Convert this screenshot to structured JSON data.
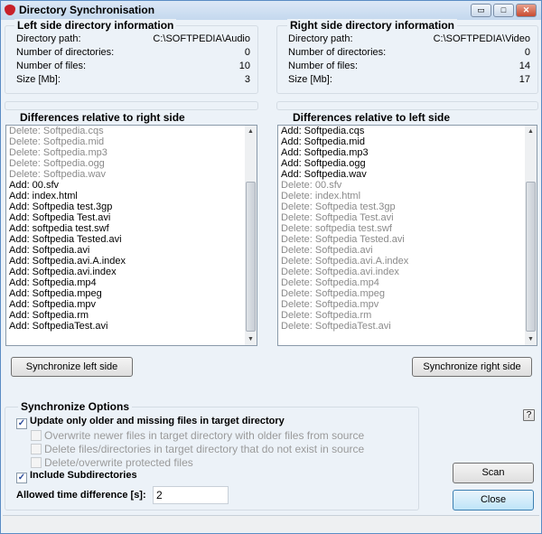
{
  "window": {
    "title": "Directory Synchronisation"
  },
  "left_info": {
    "title": "Left side directory information",
    "rows": [
      {
        "label": "Directory path:",
        "value": "C:\\SOFTPEDIA\\Audio"
      },
      {
        "label": "Number of directories:",
        "value": "0"
      },
      {
        "label": "Number of files:",
        "value": "10"
      },
      {
        "label": "Size [Mb]:",
        "value": "3"
      }
    ]
  },
  "right_info": {
    "title": "Right side directory information",
    "rows": [
      {
        "label": "Directory path:",
        "value": "C:\\SOFTPEDIA\\Video"
      },
      {
        "label": "Number of directories:",
        "value": "0"
      },
      {
        "label": "Number of files:",
        "value": "14"
      },
      {
        "label": "Size [Mb]:",
        "value": "17"
      }
    ]
  },
  "left_diff": {
    "title": "Differences relative to right side",
    "items": [
      {
        "text": "Delete: Softpedia.cqs",
        "gray": true
      },
      {
        "text": "Delete: Softpedia.mid",
        "gray": true
      },
      {
        "text": "Delete: Softpedia.mp3",
        "gray": true
      },
      {
        "text": "Delete: Softpedia.ogg",
        "gray": true
      },
      {
        "text": "Delete: Softpedia.wav",
        "gray": true
      },
      {
        "text": "Add: 00.sfv"
      },
      {
        "text": "Add: index.html"
      },
      {
        "text": "Add: Softpedia test.3gp"
      },
      {
        "text": "Add: Softpedia Test.avi"
      },
      {
        "text": "Add: softpedia test.swf"
      },
      {
        "text": "Add: Softpedia Tested.avi"
      },
      {
        "text": "Add: Softpedia.avi"
      },
      {
        "text": "Add: Softpedia.avi.A.index"
      },
      {
        "text": "Add: Softpedia.avi.index"
      },
      {
        "text": "Add: Softpedia.mp4"
      },
      {
        "text": "Add: Softpedia.mpeg"
      },
      {
        "text": "Add: Softpedia.mpv"
      },
      {
        "text": "Add: Softpedia.rm"
      },
      {
        "text": "Add: SoftpediaTest.avi"
      }
    ]
  },
  "right_diff": {
    "title": "Differences relative to left side",
    "items": [
      {
        "text": "Add: Softpedia.cqs"
      },
      {
        "text": "Add: Softpedia.mid"
      },
      {
        "text": "Add: Softpedia.mp3"
      },
      {
        "text": "Add: Softpedia.ogg"
      },
      {
        "text": "Add: Softpedia.wav"
      },
      {
        "text": "Delete: 00.sfv",
        "gray": true
      },
      {
        "text": "Delete: index.html",
        "gray": true
      },
      {
        "text": "Delete: Softpedia test.3gp",
        "gray": true
      },
      {
        "text": "Delete: Softpedia Test.avi",
        "gray": true
      },
      {
        "text": "Delete: softpedia test.swf",
        "gray": true
      },
      {
        "text": "Delete: Softpedia Tested.avi",
        "gray": true
      },
      {
        "text": "Delete: Softpedia.avi",
        "gray": true
      },
      {
        "text": "Delete: Softpedia.avi.A.index",
        "gray": true
      },
      {
        "text": "Delete: Softpedia.avi.index",
        "gray": true
      },
      {
        "text": "Delete: Softpedia.mp4",
        "gray": true
      },
      {
        "text": "Delete: Softpedia.mpeg",
        "gray": true
      },
      {
        "text": "Delete: Softpedia.mpv",
        "gray": true
      },
      {
        "text": "Delete: Softpedia.rm",
        "gray": true
      },
      {
        "text": "Delete: SoftpediaTest.avi",
        "gray": true
      }
    ]
  },
  "buttons": {
    "sync_left": "Synchronize left side",
    "sync_right": "Synchronize right side",
    "scan": "Scan",
    "close": "Close",
    "help": "?"
  },
  "options": {
    "title": "Synchronize Options",
    "update_only": {
      "label": "Update only older and missing files in target directory",
      "checked": true
    },
    "overwrite_newer": {
      "label": "Overwrite newer files in target directory with older files from source",
      "checked": false
    },
    "delete_missing": {
      "label": "Delete files/directories in target directory that do not exist in source",
      "checked": false
    },
    "delete_protected": {
      "label": "Delete/overwrite protected files",
      "checked": false
    },
    "include_subdirs": {
      "label": "Include Subdirectories",
      "checked": true
    },
    "time_diff_label": "Allowed time difference [s]:",
    "time_diff_value": "2"
  }
}
